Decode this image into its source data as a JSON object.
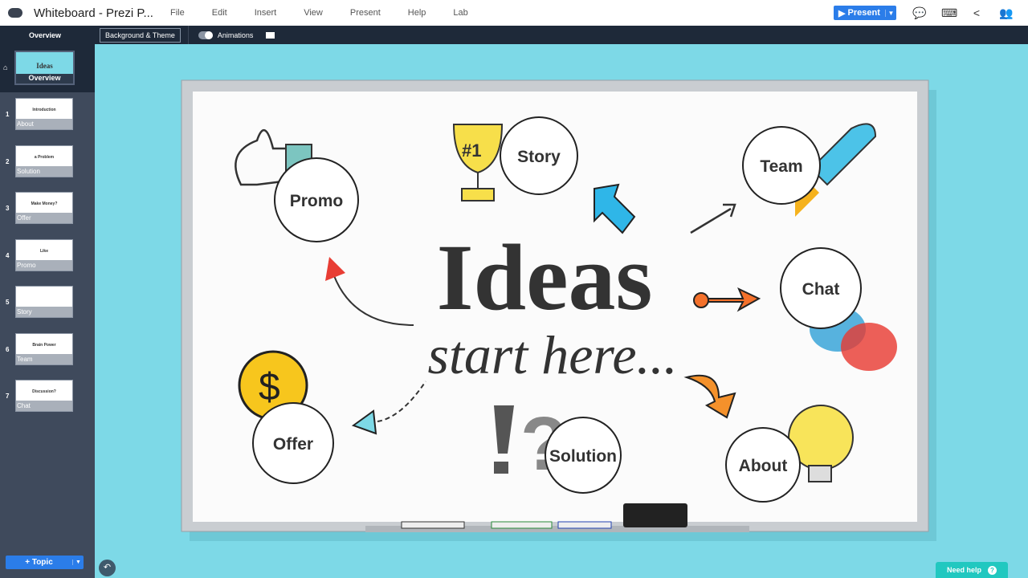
{
  "app": {
    "title": "Whiteboard - Prezi P...",
    "menu": [
      "File",
      "Edit",
      "Insert",
      "View",
      "Present",
      "Help",
      "Lab"
    ],
    "present_label": "Present"
  },
  "toolbar": {
    "overview": "Overview",
    "background_theme": "Background & Theme",
    "animations": "Animations"
  },
  "sidebar": {
    "overview_label": "Overview",
    "overview_thumb_title": "Ideas",
    "slides": [
      {
        "num": "1",
        "label": "About",
        "title": "Introduction"
      },
      {
        "num": "2",
        "label": "Solution",
        "title": "a Problem"
      },
      {
        "num": "3",
        "label": "Offer",
        "title": "Make Money?"
      },
      {
        "num": "4",
        "label": "Promo",
        "title": "Like"
      },
      {
        "num": "5",
        "label": "Story",
        "title": ""
      },
      {
        "num": "6",
        "label": "Team",
        "title": "Brain Power"
      },
      {
        "num": "7",
        "label": "Chat",
        "title": "Discussion?"
      }
    ],
    "topic_button": "+ Topic"
  },
  "canvas": {
    "headline": "Ideas",
    "subline": "start here...",
    "topics": [
      "Promo",
      "Story",
      "Team",
      "Chat",
      "Offer",
      "Solution",
      "About"
    ],
    "background_color": "#7dd9e7"
  },
  "help": {
    "label": "Need help"
  }
}
